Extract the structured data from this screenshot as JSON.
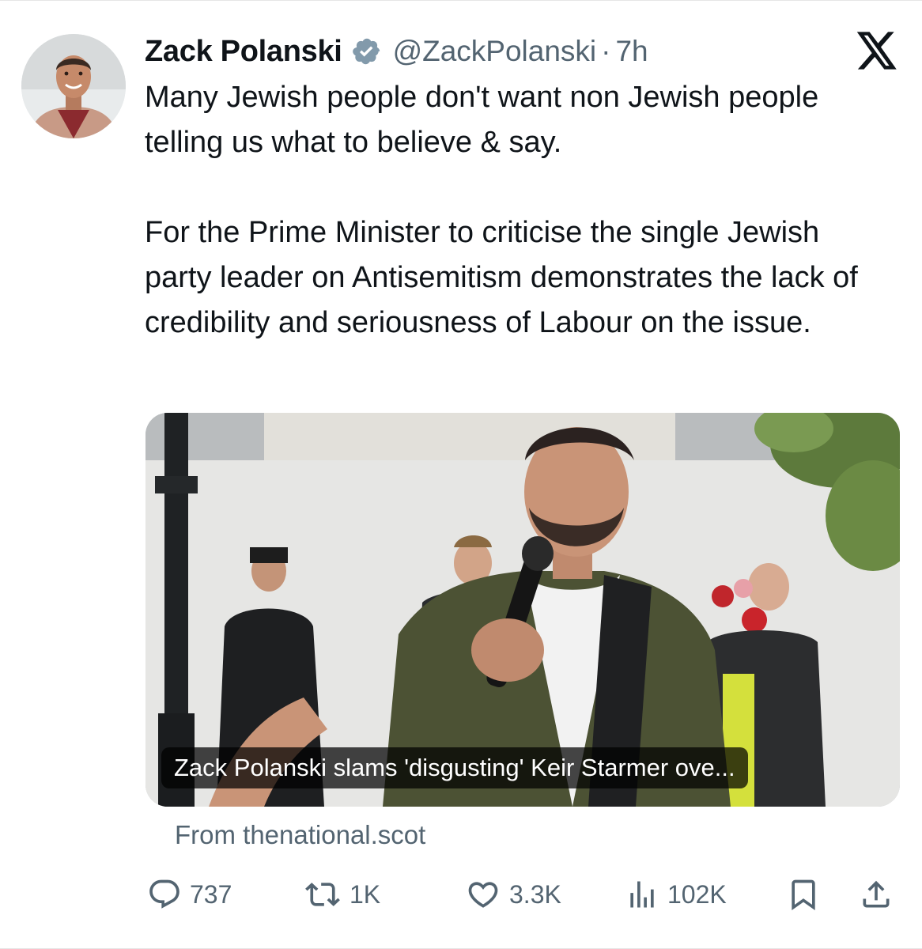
{
  "tweet": {
    "author_name": "Zack Polanski",
    "handle": "@ZackPolanski",
    "separator": "·",
    "time": "7h",
    "paragraph_1": "Many Jewish people don't want non Jewish people telling us what to believe & say.",
    "paragraph_2": "For the Prime Minister to criticise the single Jewish party leader on Antisemitism demonstrates the lack of credibility and seriousness of Labour on the issue."
  },
  "link_card": {
    "caption": "Zack Polanski slams 'disgusting' Keir Starmer ove...",
    "source": "From thenational.scot"
  },
  "actions": {
    "replies": "737",
    "reposts": "1K",
    "likes": "3.3K",
    "views": "102K"
  },
  "icons": {
    "verified": "verified-badge-icon",
    "platform": "x-logo-icon",
    "reply": "reply-icon",
    "repost": "repost-icon",
    "like": "heart-icon",
    "views": "views-icon",
    "bookmark": "bookmark-icon",
    "share": "share-icon"
  },
  "colors": {
    "text_primary": "#0f1419",
    "text_secondary": "#536471",
    "verified_gray": "#829aab"
  }
}
